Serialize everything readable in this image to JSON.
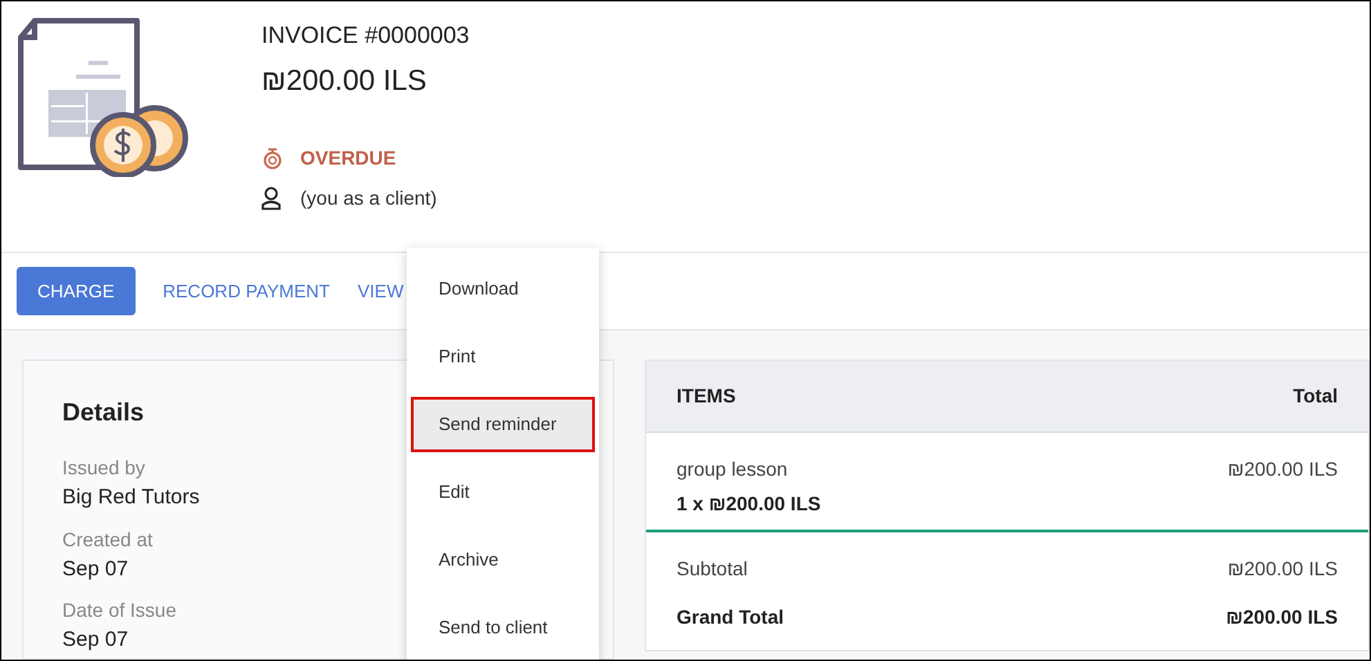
{
  "invoice": {
    "title": "INVOICE #0000003",
    "amount": "₪200.00 ILS",
    "status": "OVERDUE",
    "client": "(you as a client)"
  },
  "actions": [
    {
      "label": "CHARGE",
      "kind": "primary"
    },
    {
      "label": "RECORD PAYMENT",
      "kind": "link"
    },
    {
      "label": "VIEW",
      "kind": "link"
    }
  ],
  "menu": [
    {
      "label": "Download",
      "highlighted": false
    },
    {
      "label": "Print",
      "highlighted": false
    },
    {
      "label": "Send reminder",
      "highlighted": true
    },
    {
      "label": "Edit",
      "highlighted": false
    },
    {
      "label": "Archive",
      "highlighted": false
    },
    {
      "label": "Send to client",
      "highlighted": false
    }
  ],
  "details": {
    "title": "Details",
    "fields": [
      {
        "label": "Issued by",
        "value": "Big Red Tutors"
      },
      {
        "label": "Created at",
        "value": "Sep 07"
      },
      {
        "label": "Date of Issue",
        "value": "Sep 07"
      }
    ]
  },
  "items": {
    "columns": [
      "ITEMS",
      "Total"
    ],
    "rows": [
      {
        "name": "group lesson",
        "quantity": "1 x ₪200.00 ILS",
        "total": "₪200.00 ILS"
      }
    ],
    "subtotal": {
      "label": "Subtotal",
      "value": "₪200.00 ILS"
    },
    "grand_total": {
      "label": "Grand Total",
      "value": "₪200.00 ILS"
    }
  }
}
